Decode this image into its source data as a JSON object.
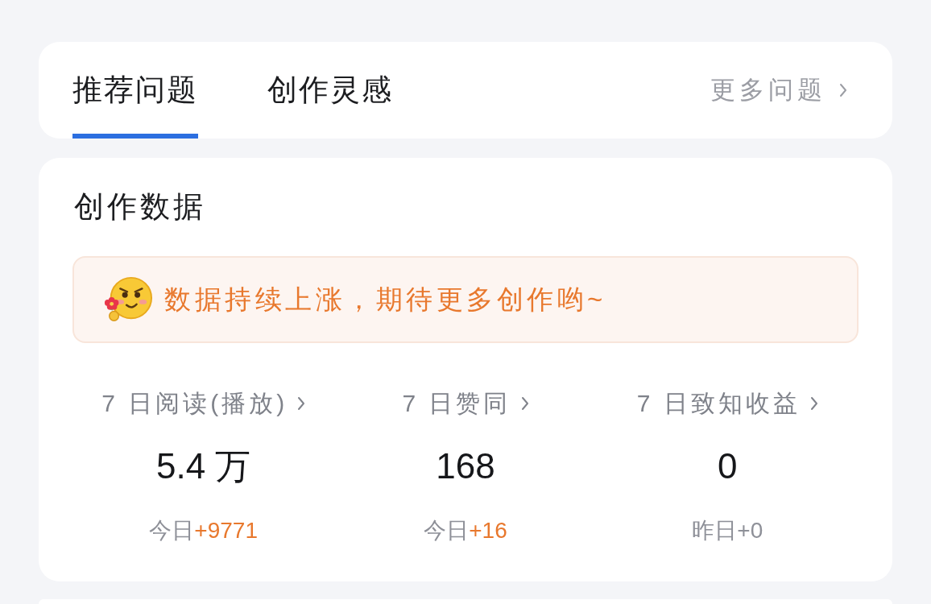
{
  "tabs": [
    {
      "label": "推荐问题",
      "selected": true
    },
    {
      "label": "创作灵感",
      "selected": false
    }
  ],
  "more_link": {
    "label": "更多问题"
  },
  "creation_data": {
    "title": "创作数据",
    "banner": {
      "message": "数据持续上涨，期待更多创作哟~"
    },
    "stats": [
      {
        "label": "7 日阅读(播放)",
        "value": "5.4 万",
        "change_label": "今日",
        "change": "+9771",
        "highlighted": true
      },
      {
        "label": "7 日赞同",
        "value": "168",
        "change_label": "今日",
        "change": "+16",
        "highlighted": true
      },
      {
        "label": "7 日致知收益",
        "value": "0",
        "change_label": "昨日",
        "change": "+0",
        "highlighted": false
      }
    ]
  }
}
